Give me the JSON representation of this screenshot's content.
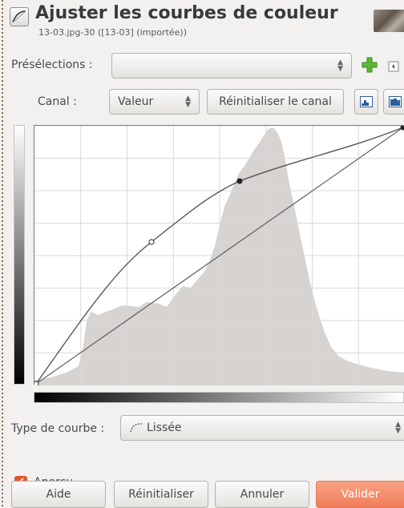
{
  "header": {
    "title": "Ajuster les courbes de couleur",
    "subtitle": "13-03.jpg-30 ([13-03] (importée))",
    "icon": "curves-icon"
  },
  "presets": {
    "label": "Présélections :",
    "value": "",
    "add_icon": "plus-icon"
  },
  "channel": {
    "label": "Canal :",
    "value": "Valeur",
    "reset_label": "Réinitialiser le canal"
  },
  "curve_type": {
    "label": "Type de courbe :",
    "value": "Lissée"
  },
  "preview": {
    "label": "Aperçu",
    "checked": true
  },
  "buttons": {
    "help": "Aide",
    "reset": "Réinitialiser",
    "cancel": "Annuler",
    "ok": "Valider"
  },
  "colors": {
    "accent": "#f07e58",
    "checkbox": "#e2572b",
    "histogram": "#d6d3d0",
    "grid": "#d9d9d9",
    "curve": "#555555"
  }
}
